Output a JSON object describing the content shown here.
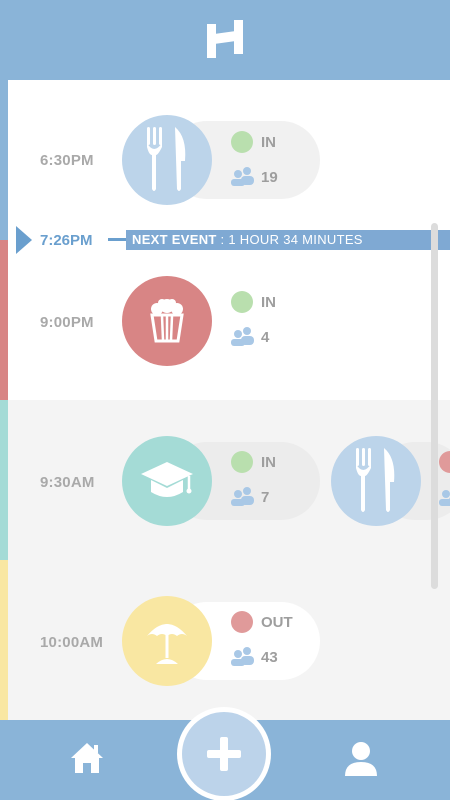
{
  "header": {
    "logo": "H logo"
  },
  "now": {
    "time": "7:26PM",
    "label": "NEXT EVENT",
    "countdown": ": 1 HOUR 34 MINUTES"
  },
  "events": [
    {
      "time": "6:30PM",
      "icon": "fork-knife-icon",
      "status": "IN",
      "count": "19",
      "color": "#bcd4ea"
    },
    {
      "time": "9:00PM",
      "icon": "popcorn-icon",
      "status": "IN",
      "count": "4",
      "color": "#d88585"
    },
    {
      "time": "9:30AM",
      "icon": "graduation-cap-icon",
      "status": "IN",
      "count": "7",
      "color": "#a4dbd6"
    },
    {
      "time": "10:00AM",
      "icon": "beach-umbrella-icon",
      "status": "OUT",
      "count": "43",
      "color": "#f9e7a2"
    }
  ],
  "footer": {
    "home": "home-icon",
    "add": "plus-icon",
    "profile": "user-icon"
  }
}
